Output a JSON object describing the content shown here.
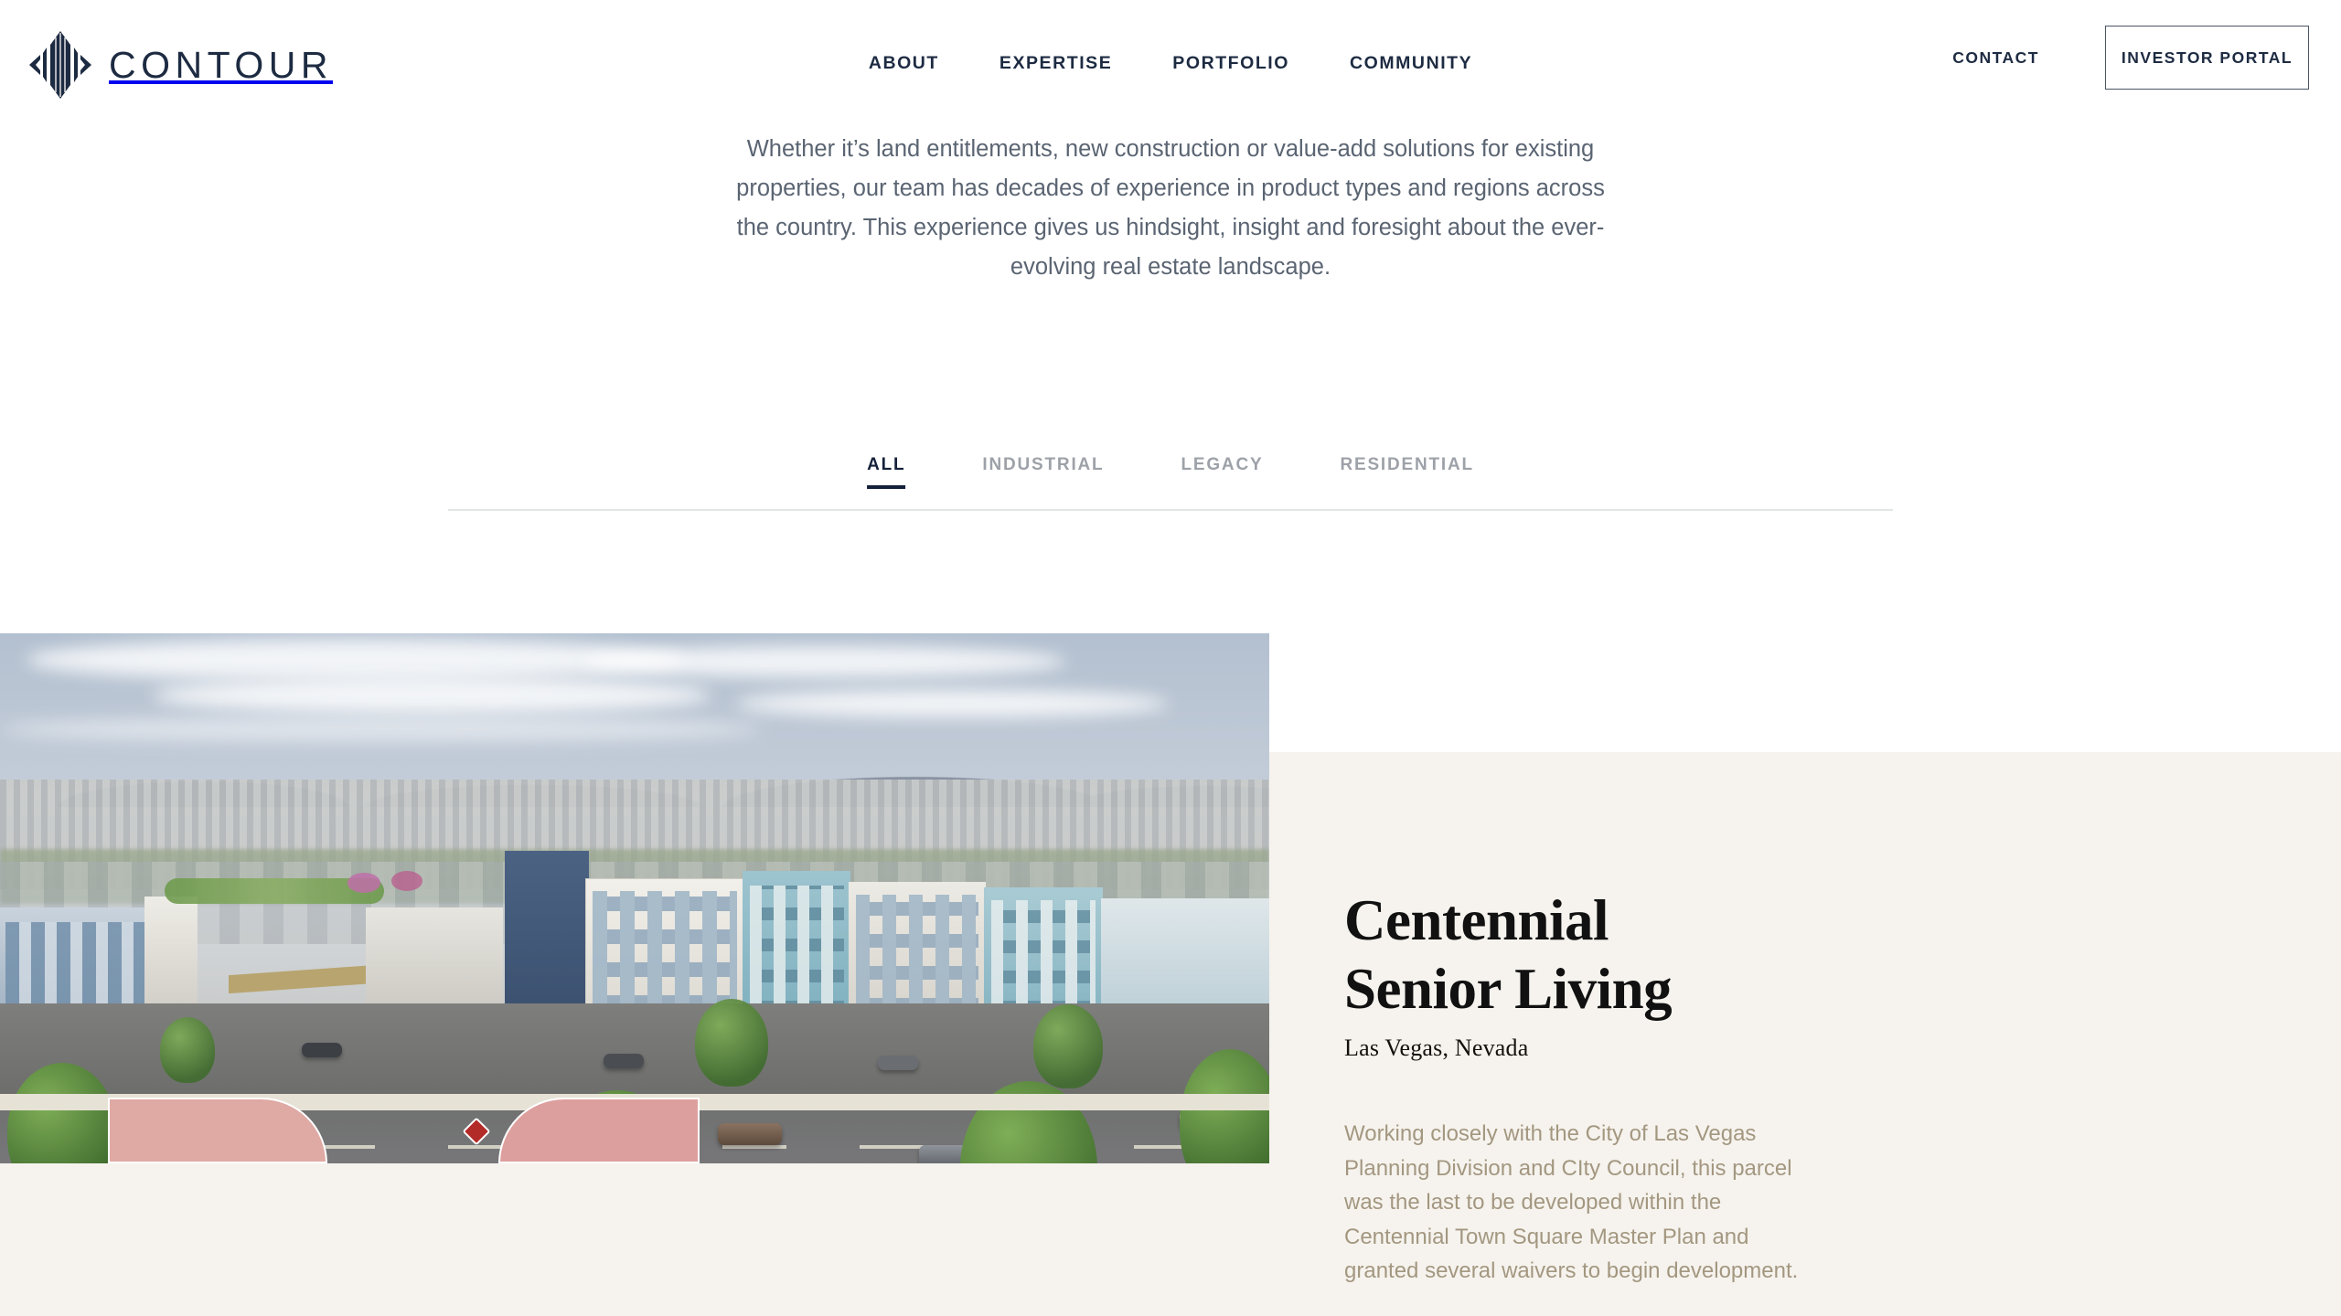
{
  "brand": {
    "name": "CONTOUR",
    "logo_icon": "contour-diamond-logo",
    "logo_color": "#1d2b42"
  },
  "nav": {
    "items": [
      {
        "label": "ABOUT"
      },
      {
        "label": "EXPERTISE"
      },
      {
        "label": "PORTFOLIO"
      },
      {
        "label": "COMMUNITY"
      }
    ],
    "contact_label": "CONTACT",
    "portal_label": "INVESTOR PORTAL"
  },
  "intro": {
    "paragraph": "Whether it’s land entitlements, new construction or value-add solutions for existing properties, our team has decades of experience in product types and regions across the country. This experience gives us hindsight, insight and foresight about the ever-evolving real estate landscape."
  },
  "filters": {
    "items": [
      {
        "label": "ALL",
        "active": true
      },
      {
        "label": "INDUSTRIAL",
        "active": false
      },
      {
        "label": "LEGACY",
        "active": false
      },
      {
        "label": "RESIDENTIAL",
        "active": false
      }
    ]
  },
  "project": {
    "title_line1": "Centennial",
    "title_line2": "Senior Living",
    "location": "Las Vegas, Nevada",
    "description": "Working closely with the City of Las Vegas Planning Division and CIty Council, this parcel was the last to be developed within the Centennial Town Square Master Plan and granted several waivers to begin development.",
    "image_alt": "aerial-rendering-senior-living-community",
    "panel_color": "#f6f3ee",
    "body_text_color": "#a39780"
  }
}
